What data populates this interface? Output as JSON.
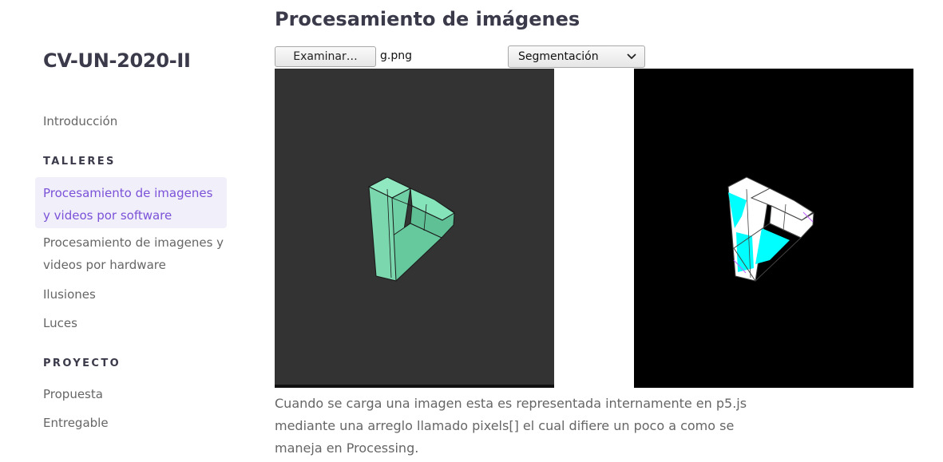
{
  "sidebar": {
    "site_title": "CV-UN-2020-II",
    "intro_link": "Introducción",
    "section_talleres": "TALLERES",
    "items_talleres": [
      "Procesamiento de imagenes y videos por software",
      "Procesamiento de imagenes y videos por hardware",
      "Ilusiones",
      "Luces"
    ],
    "section_proyecto": "PROYECTO",
    "items_proyecto": [
      "Propuesta",
      "Entregable"
    ]
  },
  "main": {
    "title": "Procesamiento de imágenes",
    "file_button_label": "Examinar…",
    "file_name": "g.png",
    "select_value": "Segmentación",
    "paragraph": "Cuando se carga una imagen esta es representada internamente en p5.js mediante una arreglo llamado pixels[] el cual difiere un poco a como se maneja en Processing."
  },
  "colors": {
    "accent": "#7b52d8",
    "active_bg": "#f0effa",
    "shape_green": "#6fd3a8",
    "shape_cyan": "#00ffff"
  }
}
